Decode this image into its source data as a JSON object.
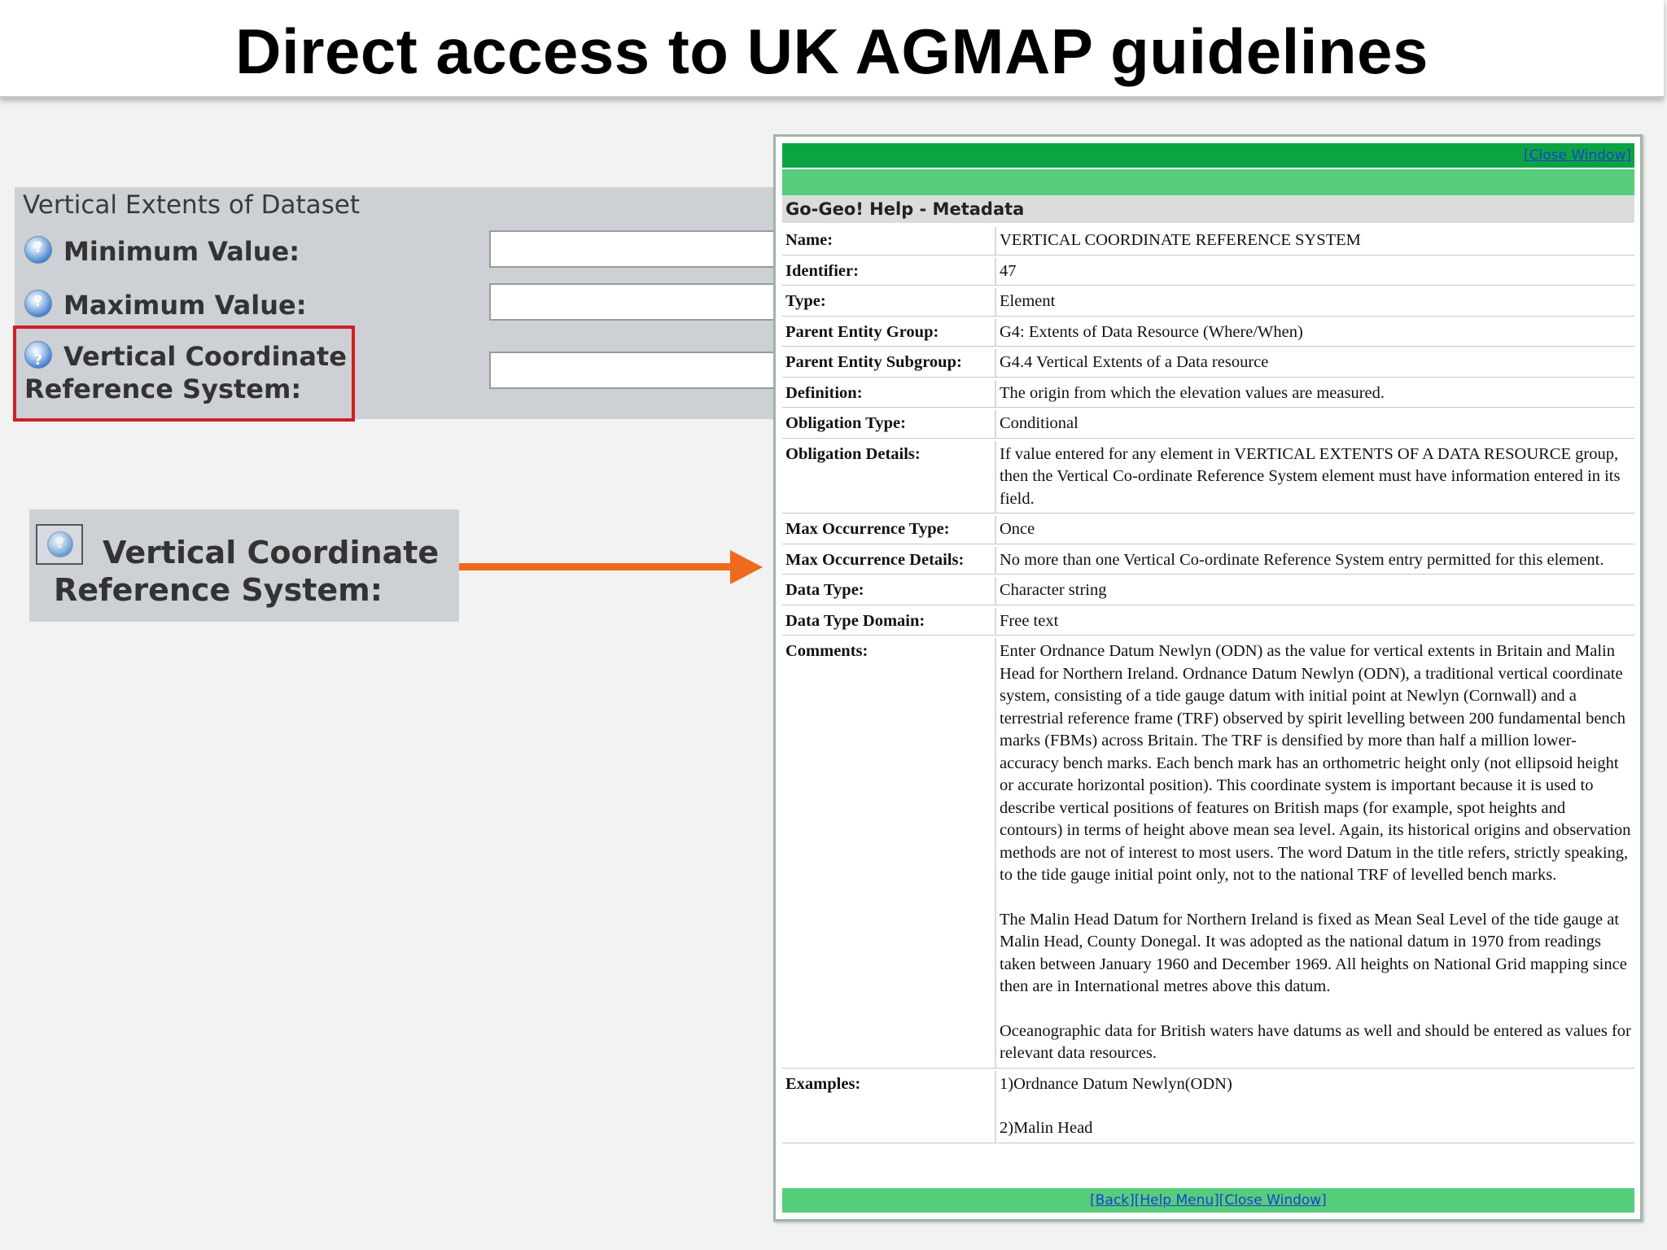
{
  "slide": {
    "title": "Direct access to UK AGMAP guidelines"
  },
  "form": {
    "section_title": "Vertical Extents of Dataset",
    "fields": {
      "minimum_label": "Minimum Value:",
      "maximum_label": "Maximum Value:",
      "vcrs_label_line1": "Vertical Coordinate",
      "vcrs_label_line2": "Reference System:"
    }
  },
  "zoom": {
    "line1": "Vertical Coordinate",
    "line2": "Reference System:"
  },
  "help_window": {
    "close_top": "[Close Window]",
    "title": "Go-Geo! Help - Metadata",
    "rows": [
      {
        "key": "Name:",
        "value": "VERTICAL COORDINATE REFERENCE SYSTEM"
      },
      {
        "key": "Identifier:",
        "value": "47"
      },
      {
        "key": "Type:",
        "value": "Element"
      },
      {
        "key": "Parent Entity Group:",
        "value": "G4: Extents of Data Resource (Where/When)"
      },
      {
        "key": "Parent Entity Subgroup:",
        "value": "G4.4 Vertical Extents of a Data resource"
      },
      {
        "key": "Definition:",
        "value": "The origin from which the elevation values are measured."
      },
      {
        "key": "Obligation Type:",
        "value": "Conditional"
      },
      {
        "key": "Obligation Details:",
        "value": "If value entered for any element in VERTICAL EXTENTS OF A DATA RESOURCE group, then the Vertical Co-ordinate Reference System element must have information entered in its field."
      },
      {
        "key": "Max Occurrence Type:",
        "value": "Once"
      },
      {
        "key": "Max Occurrence Details:",
        "value": "No more than one Vertical Co-ordinate Reference System entry permitted for this element."
      },
      {
        "key": "Data Type:",
        "value": "Character string"
      },
      {
        "key": "Data Type Domain:",
        "value": "Free text"
      }
    ],
    "comments": {
      "key": "Comments:",
      "p1": "Enter Ordnance Datum Newlyn (ODN) as the value for vertical extents in Britain and Malin Head for Northern Ireland. Ordnance Datum Newlyn (ODN), a traditional vertical coordinate system, consisting of a tide gauge datum with initial point at Newlyn (Cornwall) and a terrestrial reference frame (TRF) observed by spirit levelling between 200 fundamental bench marks (FBMs) across Britain. The TRF is densified by more than half a million lower-accuracy bench marks. Each bench mark has an orthometric height only (not ellipsoid height or accurate horizontal position). This coordinate system is important because it is used to describe vertical positions of features on British maps (for example, spot heights and contours) in terms of height above mean sea level. Again, its historical origins and observation methods are not of interest to most users. The word Datum in the title refers, strictly speaking, to the tide gauge initial point only, not to the national TRF of levelled bench marks.",
      "p2": "The Malin Head Datum for Northern Ireland is fixed as Mean Seal Level of the tide gauge at Malin Head, County Donegal. It was adopted as the national datum in 1970 from readings taken between January 1960 and December 1969. All heights on National Grid mapping since then are in International metres above this datum.",
      "p3": "Oceanographic data for British waters have datums as well and should be entered as values for relevant data resources."
    },
    "examples": {
      "key": "Examples:",
      "e1": "1)Ordnance Datum Newlyn(ODN)",
      "e2": "2)Malin Head"
    },
    "bottom_links": "[Back][Help Menu][Close Window]"
  },
  "colors": {
    "window_green": "#0ca443",
    "window_light_green": "#56cd7b",
    "arrow": "#ef6a1c",
    "highlight": "#d01f26"
  },
  "icons": [
    "help-question-icon",
    "arrow-right-icon"
  ]
}
